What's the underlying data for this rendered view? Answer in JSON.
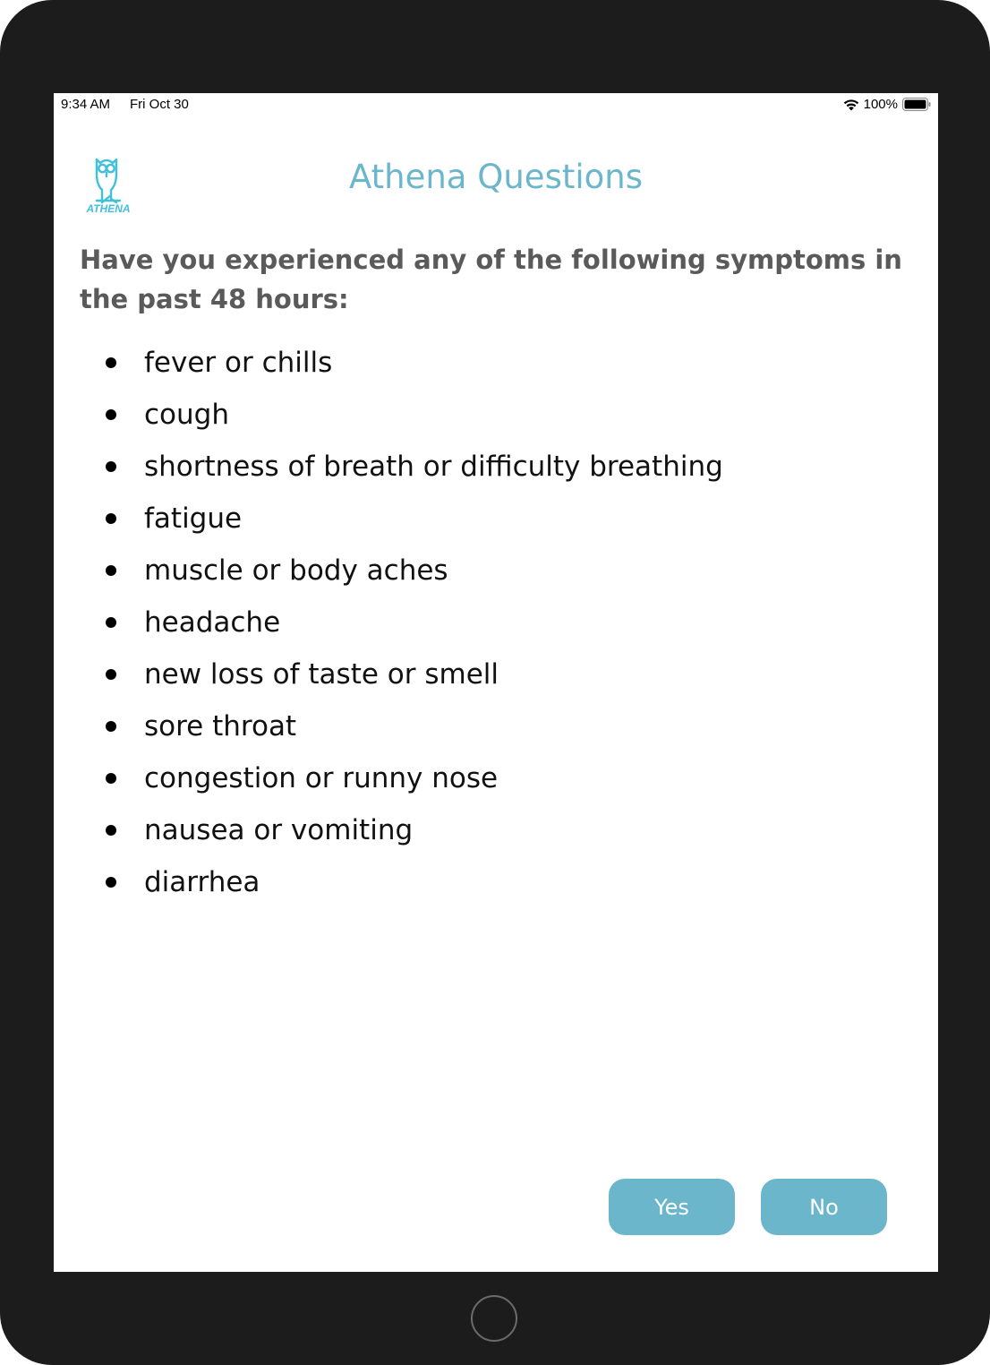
{
  "status_bar": {
    "time": "9:34 AM",
    "date": "Fri Oct 30",
    "battery_percent": "100%",
    "wifi_icon": "wifi-icon",
    "battery_icon": "battery-full-icon"
  },
  "header": {
    "logo_text": "ATHENA",
    "logo_icon": "owl-icon",
    "title": "Athena Questions"
  },
  "question": "Have you experienced any of the following symptoms in the past 48 hours:",
  "symptoms": [
    "fever or chills",
    "cough",
    "shortness of breath or difficulty breathing",
    "fatigue",
    "muscle or body aches",
    "headache",
    "new loss of taste or smell",
    "sore throat",
    "congestion or runny nose",
    "nausea or vomiting",
    "diarrhea"
  ],
  "actions": {
    "yes_label": "Yes",
    "no_label": "No"
  },
  "colors": {
    "accent": "#6cb6cc",
    "logo": "#3fc0dc",
    "question_text": "#5a5a5a",
    "device_frame": "#1c1c1c"
  }
}
